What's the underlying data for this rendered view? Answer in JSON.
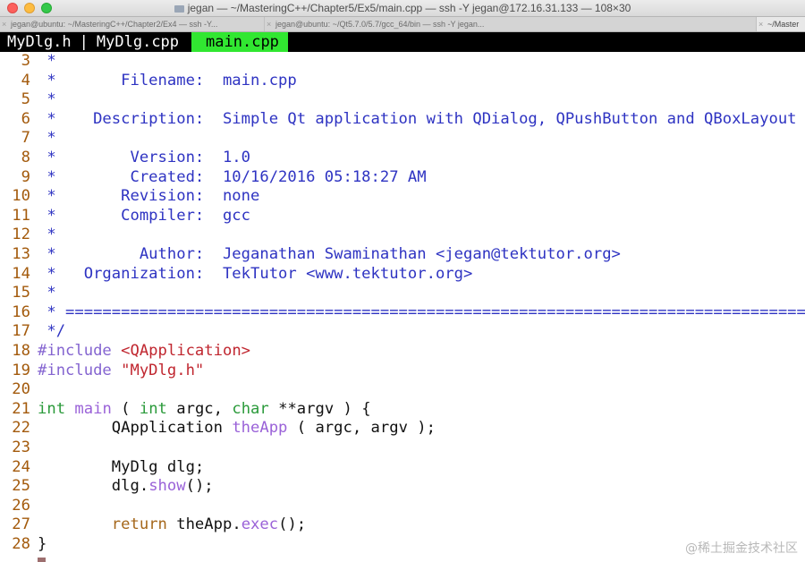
{
  "window": {
    "title": "jegan — ~/MasteringC++/Chapter5/Ex5/main.cpp — ssh -Y jegan@172.16.31.133 — 108×30",
    "tabs": [
      {
        "label": "jegan@ubuntu: ~/MasteringC++/Chapter2/Ex4 — ssh -Y..."
      },
      {
        "label": "jegan@ubuntu: ~/Qt5.7.0/5.7/gcc_64/bin — ssh -Y jegan..."
      },
      {
        "label": "~/Master"
      }
    ]
  },
  "vim_tabs": [
    {
      "label": "MyDlg.h"
    },
    {
      "label": "|"
    },
    {
      "label": "MyDlg.cpp"
    },
    {
      "label": "main.cpp"
    }
  ],
  "colors": {
    "comment": "#2e33c2",
    "line_number": "#a35a0c",
    "preprocessor": "#8464d0",
    "string": "#c0262f",
    "type": "#2a9a3a",
    "function": "#9a62d8",
    "keyword": "#a5671b",
    "tab_active": "#31e731"
  },
  "code": {
    "lines": [
      {
        "n": "3",
        "segs": [
          {
            "t": " *",
            "c": "cmt"
          }
        ]
      },
      {
        "n": "4",
        "segs": [
          {
            "t": " *       Filename:  main.cpp",
            "c": "cmt"
          }
        ]
      },
      {
        "n": "5",
        "segs": [
          {
            "t": " *",
            "c": "cmt"
          }
        ]
      },
      {
        "n": "6",
        "segs": [
          {
            "t": " *    Description:  Simple Qt application with QDialog, QPushButton and QBoxLayout",
            "c": "cmt"
          }
        ]
      },
      {
        "n": "7",
        "segs": [
          {
            "t": " *",
            "c": "cmt"
          }
        ]
      },
      {
        "n": "8",
        "segs": [
          {
            "t": " *        Version:  1.0",
            "c": "cmt"
          }
        ]
      },
      {
        "n": "9",
        "segs": [
          {
            "t": " *        Created:  10/16/2016 05:18:27 AM",
            "c": "cmt"
          }
        ]
      },
      {
        "n": "10",
        "segs": [
          {
            "t": " *       Revision:  none",
            "c": "cmt"
          }
        ]
      },
      {
        "n": "11",
        "segs": [
          {
            "t": " *       Compiler:  gcc",
            "c": "cmt"
          }
        ]
      },
      {
        "n": "12",
        "segs": [
          {
            "t": " *",
            "c": "cmt"
          }
        ]
      },
      {
        "n": "13",
        "segs": [
          {
            "t": " *         Author:  Jeganathan Swaminathan <jegan@tektutor.org>",
            "c": "cmt"
          }
        ]
      },
      {
        "n": "14",
        "segs": [
          {
            "t": " *   Organization:  TekTutor <www.tektutor.org>",
            "c": "cmt"
          }
        ]
      },
      {
        "n": "15",
        "segs": [
          {
            "t": " *",
            "c": "cmt"
          }
        ]
      },
      {
        "n": "16",
        "segs": [
          {
            "t": " * =====================================================================================",
            "c": "cmt"
          }
        ]
      },
      {
        "n": "17",
        "segs": [
          {
            "t": " */",
            "c": "cmt"
          }
        ]
      },
      {
        "n": "18",
        "segs": [
          {
            "t": "#include ",
            "c": "pre"
          },
          {
            "t": "<QApplication>",
            "c": "str"
          }
        ]
      },
      {
        "n": "19",
        "segs": [
          {
            "t": "#include ",
            "c": "pre"
          },
          {
            "t": "\"MyDlg.h\"",
            "c": "str"
          }
        ]
      },
      {
        "n": "20",
        "segs": []
      },
      {
        "n": "21",
        "segs": [
          {
            "t": "int",
            "c": "type"
          },
          {
            "t": " ",
            "c": "plain"
          },
          {
            "t": "main",
            "c": "fn"
          },
          {
            "t": " ( ",
            "c": "plain"
          },
          {
            "t": "int",
            "c": "type"
          },
          {
            "t": " argc, ",
            "c": "plain"
          },
          {
            "t": "char",
            "c": "type"
          },
          {
            "t": " **argv ) {",
            "c": "plain"
          }
        ]
      },
      {
        "n": "22",
        "segs": [
          {
            "t": "        QApplication ",
            "c": "plain"
          },
          {
            "t": "theApp",
            "c": "fn"
          },
          {
            "t": " ( argc, argv );",
            "c": "plain"
          }
        ]
      },
      {
        "n": "23",
        "segs": []
      },
      {
        "n": "24",
        "segs": [
          {
            "t": "        MyDlg dlg;",
            "c": "plain"
          }
        ]
      },
      {
        "n": "25",
        "segs": [
          {
            "t": "        dlg.",
            "c": "plain"
          },
          {
            "t": "show",
            "c": "fn"
          },
          {
            "t": "();",
            "c": "plain"
          }
        ]
      },
      {
        "n": "26",
        "segs": []
      },
      {
        "n": "27",
        "segs": [
          {
            "t": "        ",
            "c": "plain"
          },
          {
            "t": "return",
            "c": "kw"
          },
          {
            "t": " theApp.",
            "c": "plain"
          },
          {
            "t": "exec",
            "c": "fn"
          },
          {
            "t": "();",
            "c": "plain"
          }
        ]
      },
      {
        "n": "28",
        "segs": [
          {
            "t": "}",
            "c": "plain"
          }
        ]
      }
    ]
  },
  "watermark": "@稀土掘金技术社区"
}
